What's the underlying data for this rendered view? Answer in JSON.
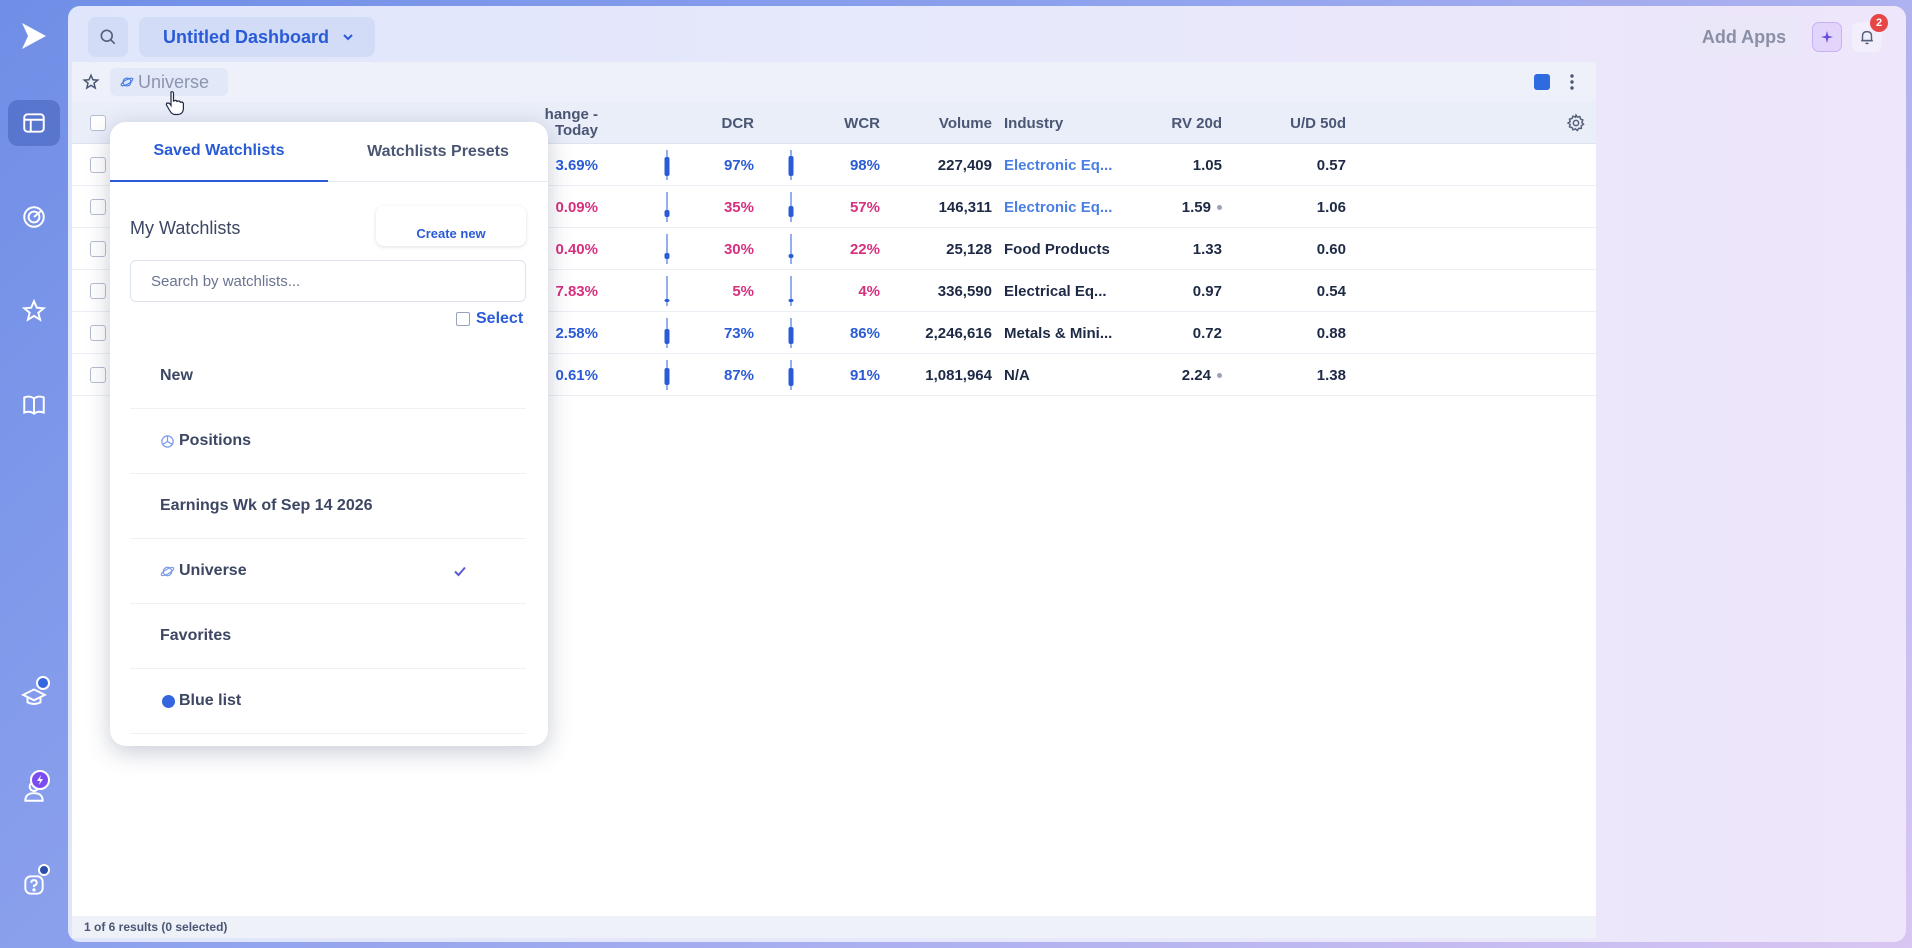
{
  "app": {
    "dashboard_title": "Untitled Dashboard",
    "add_apps_label": "Add Apps",
    "notification_count": "2"
  },
  "colors": {
    "accent": "#2a5bd7",
    "positive": "#2a5bd7",
    "negative": "#d6307e",
    "badge": "#e64646"
  },
  "widget": {
    "tab_label": "Universe",
    "columns": {
      "change_today": [
        "hange -",
        "Today"
      ],
      "dcr": "DCR",
      "wcr": "WCR",
      "volume": "Volume",
      "industry": "Industry",
      "rv20d": "RV 20d",
      "ud50d": "U/D 50d"
    },
    "rows": [
      {
        "change": "3.69%",
        "dir": "pos",
        "dcr": "97%",
        "wcr": "98%",
        "volume": "227,409",
        "industry": "Electronic Eq...",
        "industry_link": true,
        "rv": "1.05",
        "rv_dot": false,
        "ud": "0.57"
      },
      {
        "change": "0.09%",
        "dir": "neg",
        "dcr": "35%",
        "wcr": "57%",
        "volume": "146,311",
        "industry": "Electronic Eq...",
        "industry_link": true,
        "rv": "1.59",
        "rv_dot": true,
        "ud": "1.06"
      },
      {
        "change": "0.40%",
        "dir": "neg",
        "dcr": "30%",
        "wcr": "22%",
        "volume": "25,128",
        "industry": "Food Products",
        "industry_link": false,
        "rv": "1.33",
        "rv_dot": false,
        "ud": "0.60"
      },
      {
        "change": "7.83%",
        "dir": "neg",
        "dcr": "5%",
        "wcr": "4%",
        "volume": "336,590",
        "industry": "Electrical Eq...",
        "industry_link": false,
        "rv": "0.97",
        "rv_dot": false,
        "ud": "0.54"
      },
      {
        "change": "2.58%",
        "dir": "pos",
        "dcr": "73%",
        "wcr": "86%",
        "volume": "2,246,616",
        "industry": "Metals & Mini...",
        "industry_link": false,
        "rv": "0.72",
        "rv_dot": false,
        "ud": "0.88"
      },
      {
        "change": "0.61%",
        "dir": "pos",
        "dcr": "87%",
        "wcr": "91%",
        "volume": "1,081,964",
        "industry": "N/A",
        "industry_link": false,
        "rv": "2.24",
        "rv_dot": true,
        "ud": "1.38"
      }
    ],
    "footer": "1 of 6 results (0 selected)"
  },
  "dropdown": {
    "tabs": [
      "Saved Watchlists",
      "Watchlists Presets"
    ],
    "section_title": "My Watchlists",
    "create_new_label": "Create new",
    "search_placeholder": "Search by watchlists...",
    "select_label": "Select",
    "items": [
      {
        "label": "New",
        "icon": "none"
      },
      {
        "label": "Positions",
        "icon": "pie-icon"
      },
      {
        "label": "Earnings Wk of Sep 14 2026",
        "icon": "none"
      },
      {
        "label": "Universe",
        "icon": "planet-icon",
        "selected": true
      },
      {
        "label": "Favorites",
        "icon": "none"
      },
      {
        "label": "Blue list",
        "icon": "blue-dot"
      }
    ]
  }
}
